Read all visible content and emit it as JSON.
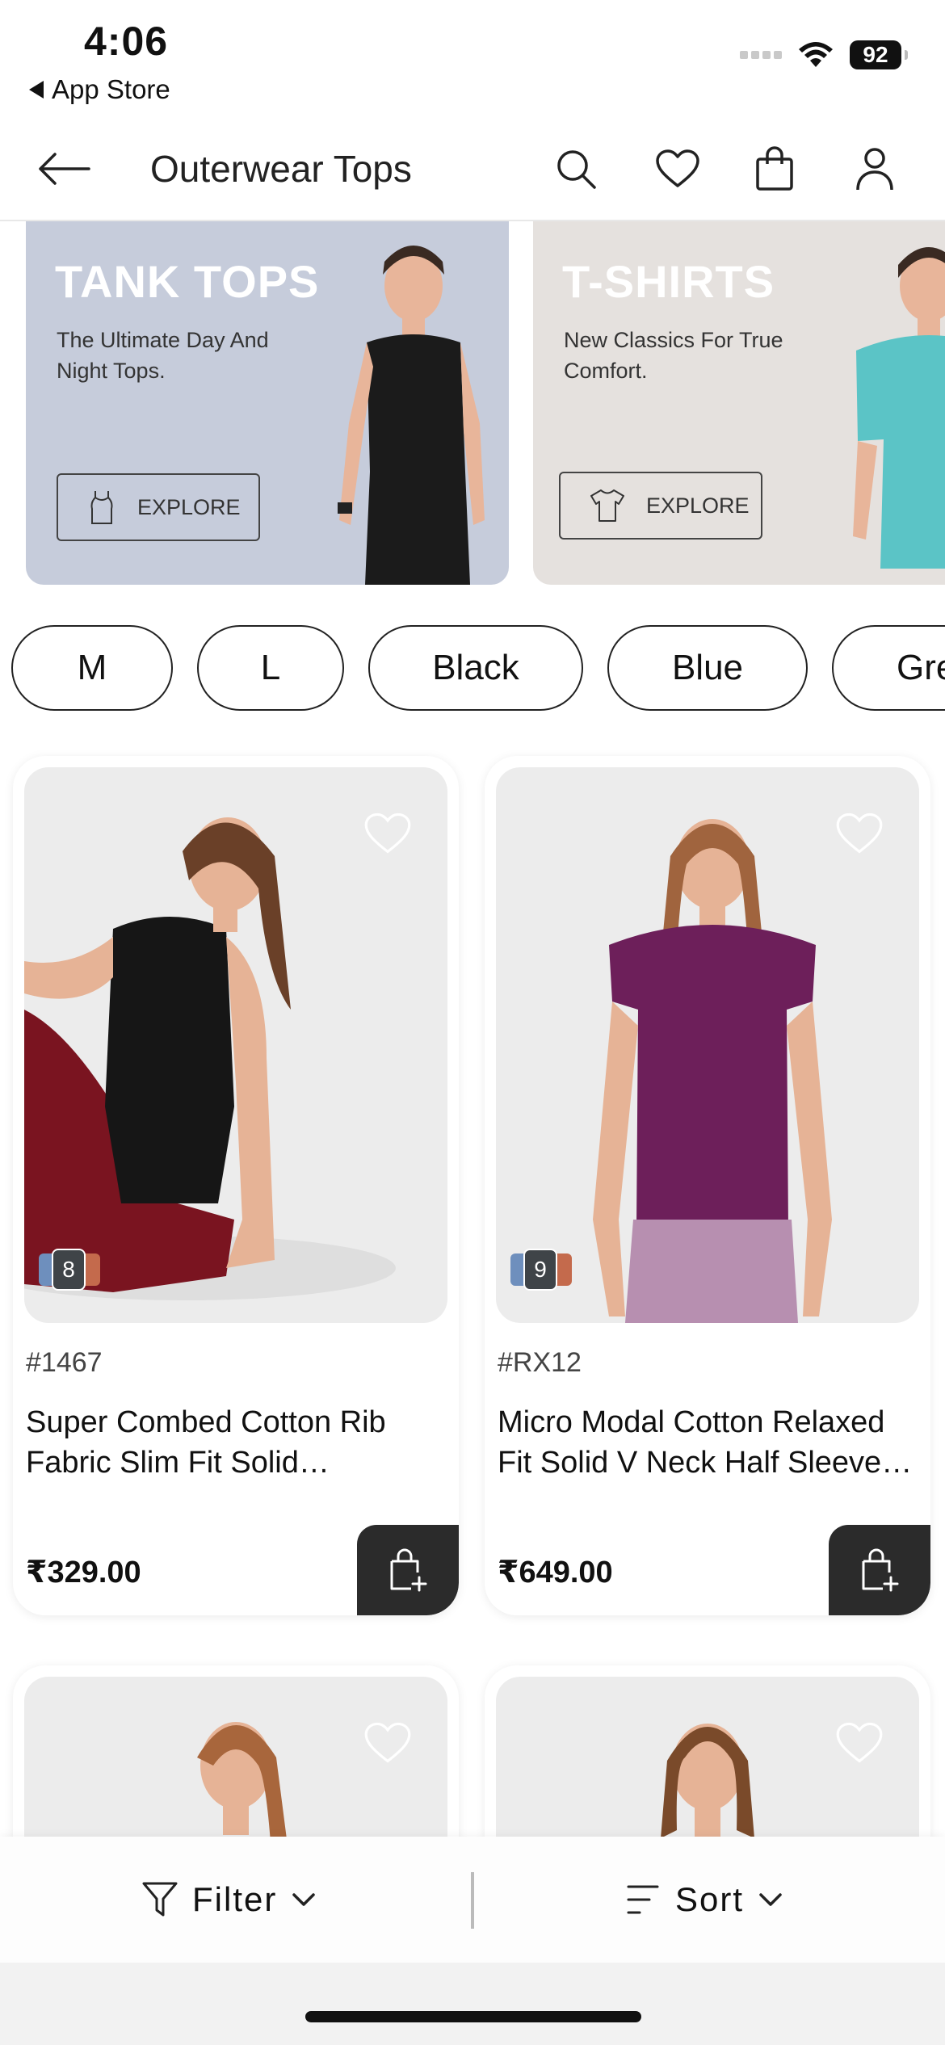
{
  "status_bar": {
    "time": "4:06",
    "back_app": "App Store",
    "battery": "92"
  },
  "header": {
    "title": "Outerwear Tops",
    "icons": [
      "back-arrow-icon",
      "search-icon",
      "heart-icon",
      "shopping-bag-icon",
      "profile-icon"
    ]
  },
  "banners": [
    {
      "title": "TANK TOPS",
      "subtitle": "The Ultimate Day And Night Tops.",
      "button": "EXPLORE",
      "background": "#c6ccdb"
    },
    {
      "title": "T-SHIRTS",
      "subtitle": "New Classics For True Comfort.",
      "button": "EXPLORE",
      "background": "#e5e1de"
    }
  ],
  "filter_chips": [
    "M",
    "L",
    "Black",
    "Blue",
    "Gre"
  ],
  "products": [
    {
      "color_count": "8",
      "sku": "#1467",
      "name": "Super Combed Cotton Rib Fabric Slim Fit Solid Racerback Tank Top",
      "price": "₹329.00",
      "garment_color": "#1b1b1b"
    },
    {
      "color_count": "9",
      "sku": "#RX12",
      "name": "Micro Modal Cotton Relaxed Fit Solid V Neck Half Sleeve T-Shirt",
      "price": "₹649.00",
      "garment_color": "#6d1f5a"
    }
  ],
  "bottom_bar": {
    "filter_label": "Filter",
    "sort_label": "Sort"
  },
  "colors": {
    "accent": "#111111",
    "cart_button": "#2b2b2b"
  }
}
